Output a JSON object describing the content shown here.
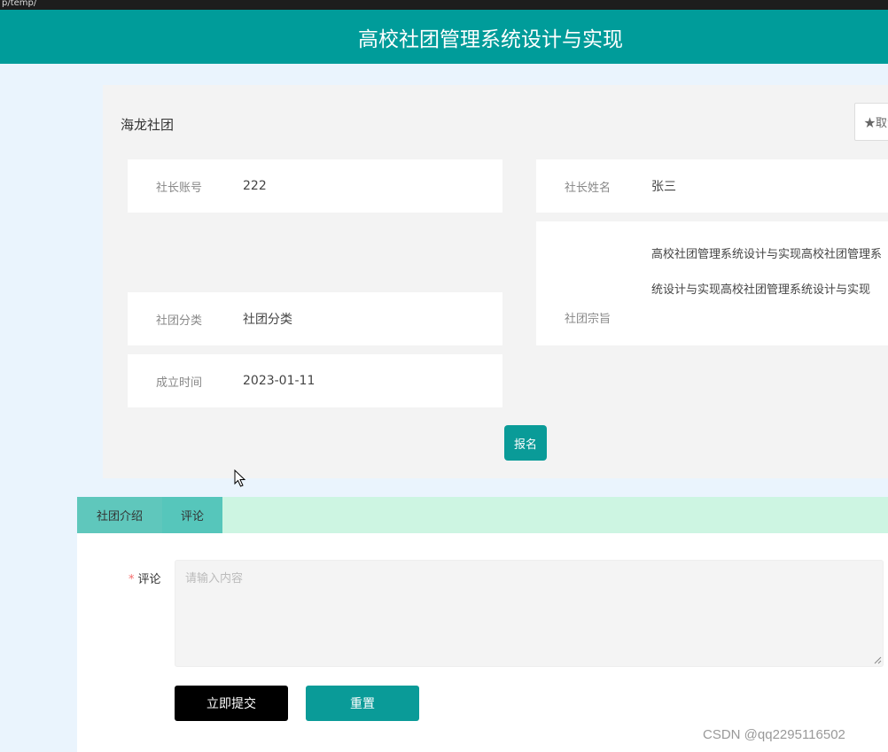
{
  "topbar": {
    "text": "p/temp/"
  },
  "header": {
    "title": "高校社团管理系统设计与实现"
  },
  "club": {
    "name": "海龙社团",
    "favorite_label": "★取消收藏",
    "fields": {
      "leader_account": {
        "label": "社长账号",
        "value": "222"
      },
      "leader_name": {
        "label": "社长姓名",
        "value": "张三"
      },
      "category": {
        "label": "社团分类",
        "value": "社团分类"
      },
      "purpose": {
        "label": "社团宗旨",
        "value": "高校社团管理系统设计与实现高校社团管理系统设计与实现高校社团管理系统设计与实现"
      },
      "founded": {
        "label": "成立时间",
        "value": "2023-01-11"
      }
    },
    "signup_label": "报名"
  },
  "tabs": [
    {
      "label": "社团介绍"
    },
    {
      "label": "评论"
    }
  ],
  "comment_form": {
    "required_mark": "*",
    "label": "评论",
    "placeholder": "请输入内容",
    "value": "",
    "submit_label": "立即提交",
    "reset_label": "重置"
  },
  "watermark": "CSDN @qq2295116502",
  "colors": {
    "primary": "#009c9a",
    "tab_bar": "#cdf5e2",
    "tab": "#5fc7bc",
    "submit": "#000000"
  }
}
